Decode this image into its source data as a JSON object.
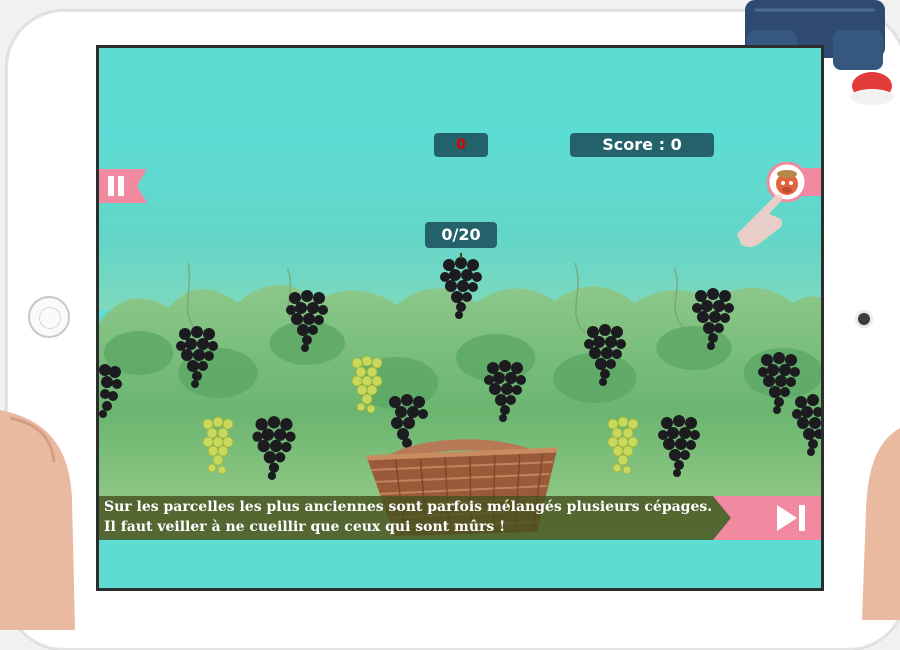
{
  "hud": {
    "timer": "0",
    "score": "Score : 0",
    "progress": "0/20"
  },
  "caption": {
    "line1": "Sur les parcelles les plus anciennes sont parfois mélangés plusieurs cépages.",
    "line2": "Il faut veiller à ne cueillir que ceux qui sont mûrs !"
  },
  "icons": {
    "pause": "pause-icon",
    "next": "next-icon",
    "mascot": "mascot-icon",
    "hint": "pointing-hand-icon"
  },
  "colors": {
    "sky": "#5ddcd4",
    "hud_bg": "#23626a",
    "timer_text": "#e00000",
    "ribbon_pink": "#f18aa0",
    "black_grape": "#1a1a1e",
    "green_grape": "#c8d95a"
  },
  "grapes": [
    {
      "kind": "black"
    },
    {
      "kind": "black"
    },
    {
      "kind": "black"
    },
    {
      "kind": "black"
    },
    {
      "kind": "black"
    },
    {
      "kind": "black"
    },
    {
      "kind": "black"
    },
    {
      "kind": "black"
    },
    {
      "kind": "black"
    },
    {
      "kind": "black"
    },
    {
      "kind": "black"
    },
    {
      "kind": "black"
    },
    {
      "kind": "green"
    },
    {
      "kind": "green"
    },
    {
      "kind": "green"
    }
  ]
}
